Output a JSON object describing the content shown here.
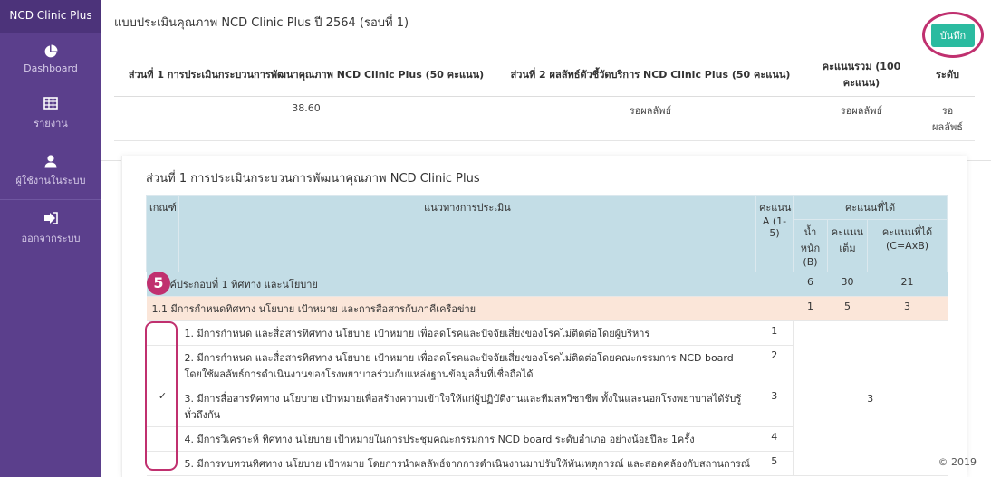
{
  "sidebar": {
    "brand": "NCD Clinic Plus",
    "items": [
      {
        "label": "Dashboard"
      },
      {
        "label": "รายงาน"
      },
      {
        "label": "ผู้ใช้งานในระบบ"
      },
      {
        "label": "ออกจากระบบ"
      }
    ]
  },
  "header": {
    "title": "แบบประเมินคุณภาพ NCD Clinic Plus ปี 2564 (รอบที่ 1)",
    "save_label": "บันทึก"
  },
  "summary": {
    "headers": [
      "ส่วนที่ 1 การประเมินกระบวนการพัฒนาคุณภาพ NCD Clinic Plus (50 คะแนน)",
      "ส่วนที่ 2 ผลลัพธ์ตัวชี้วัดบริการ NCD Clinic Plus (50 คะแนน)",
      "คะแนนรวม (100 คะแนน)",
      "ระดับ"
    ],
    "values": [
      "38.60",
      "รอผลลัพธ์",
      "รอผลลัพธ์",
      "รอ ผลลัพธ์"
    ]
  },
  "section": {
    "title": "ส่วนที่ 1 การประเมินกระบวนการพัฒนาคุณภาพ NCD Clinic Plus",
    "headers": {
      "criteria": "เกณฑ์",
      "guideline": "แนวทางการประเมิน",
      "score_a": "คะแนน A (1-5)",
      "score_group": "คะแนนที่ได้",
      "weight": "น้ำหนัก (B)",
      "full": "คะแนนเต็ม",
      "got": "คะแนนที่ได้ (C=AxB)"
    },
    "category": {
      "label": "องค์ประกอบที่ 1 ทิศทาง และนโยบาย",
      "weight": "6",
      "full": "30",
      "got": "21"
    },
    "sub": {
      "label": "1.1 มีการกำหนดทิศทาง นโยบาย เป้าหมาย และการสื่อสารกับภาคีเครือข่าย",
      "weight": "1",
      "full": "5",
      "got": "3"
    },
    "items": [
      {
        "check": "",
        "text": "1. มีการกำหนด และสื่อสารทิศทาง นโยบาย เป้าหมาย เพื่อลดโรคและปัจจัยเสี่ยงของโรคไม่ติดต่อโดยผู้บริหาร",
        "score": "1"
      },
      {
        "check": "",
        "text": "2. มีการกำหนด และสื่อสารทิศทาง นโยบาย เป้าหมาย เพื่อลดโรคและปัจจัยเสี่ยงของโรคไม่ติดต่อโดยคณะกรรมการ NCD board โดยใช้ผลลัพธ์การดำเนินงานของโรงพยาบาลร่วมกับแหล่งฐานข้อมูลอื่นที่เชื่อถือได้",
        "score": "2"
      },
      {
        "check": "✓",
        "text": "3. มีการสื่อสารทิศทาง นโยบาย เป้าหมายเพื่อสร้างความเข้าใจให้แก่ผู้ปฏิบัติงานและทีมสหวิชาชีพ ทั้งในและนอกโรงพยาบาลได้รับรู้ทั่วถึงกัน",
        "score": "3"
      },
      {
        "check": "",
        "text": "4. มีการวิเคราะห์ ทิศทาง นโยบาย เป้าหมายในการประชุมคณะกรรมการ NCD board ระดับอำเภอ อย่างน้อยปีละ 1ครั้ง",
        "score": "4"
      },
      {
        "check": "",
        "text": "5. มีการทบทวนทิศทาง นโยบาย เป้าหมาย โดยการนำผลลัพธ์จากการดำเนินงานมาปรับให้ทันเหตุการณ์ และสอดคล้องกับสถานการณ์",
        "score": "5"
      }
    ],
    "result_score": "3"
  },
  "annotation": {
    "step": "5"
  },
  "footer": {
    "copyright": "© 2019"
  },
  "colors": {
    "sidebar": "#5b3f8c",
    "accent": "#2bbba0",
    "highlight": "#c0306f",
    "table_header": "#c3dde6",
    "sub_row": "#fbe6d9"
  }
}
